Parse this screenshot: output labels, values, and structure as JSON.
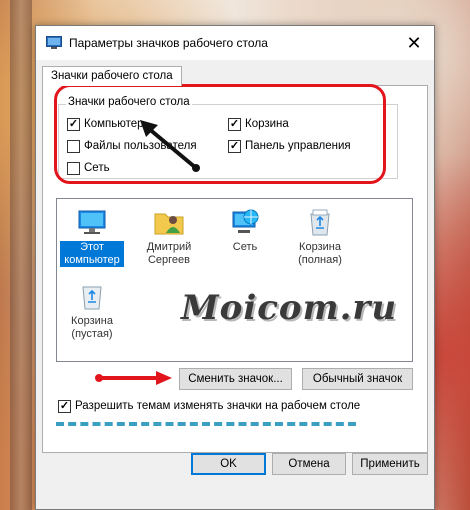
{
  "window": {
    "title": "Параметры значков рабочего стола"
  },
  "tab": {
    "label": "Значки рабочего стола"
  },
  "group": {
    "legend": "Значки рабочего стола",
    "checkboxes": [
      {
        "label": "Компьютер",
        "checked": true
      },
      {
        "label": "Корзина",
        "checked": true
      },
      {
        "label": "Файлы пользователя",
        "checked": false
      },
      {
        "label": "Панель управления",
        "checked": true
      },
      {
        "label": "Сеть",
        "checked": false
      }
    ]
  },
  "icons": [
    {
      "label": "Этот компьютер",
      "icon": "computer-icon",
      "selected": true
    },
    {
      "label": "Дмитрий Сергеев",
      "icon": "user-folder-icon",
      "selected": false
    },
    {
      "label": "Сеть",
      "icon": "network-icon",
      "selected": false
    },
    {
      "label": "Корзина (полная)",
      "icon": "recycle-bin-full-icon",
      "selected": false
    },
    {
      "label": "Корзина (пустая)",
      "icon": "recycle-bin-empty-icon",
      "selected": false
    }
  ],
  "watermark": "Moicom.ru",
  "buttons": {
    "change_icon": "Сменить значок...",
    "default_icon": "Обычный значок",
    "ok": "OK",
    "cancel": "Отмена",
    "apply": "Применить"
  },
  "allow_themes": {
    "label": "Разрешить темам изменять значки на рабочем столе",
    "checked": true
  },
  "colors": {
    "annotation_red": "#e2141c",
    "selection_blue": "#0078d7",
    "dash_blue": "#3a9fc0"
  }
}
